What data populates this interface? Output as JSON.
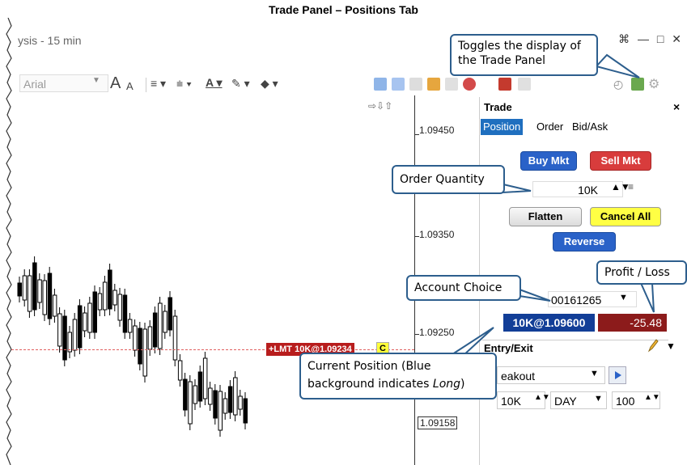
{
  "figure_title": "Trade Panel – Positions Tab",
  "window": {
    "title": "ysis - 15 min",
    "controls": "⌘ — □ ✕"
  },
  "toolbar": {
    "font": "Arial",
    "font_size_up": "A",
    "font_size_down": "A"
  },
  "chart": {
    "price_ticks": [
      "1.09450",
      "1.09350",
      "1.09250",
      "1.09158"
    ],
    "last_price": "1.09158",
    "lmt_order_label": "+LMT 10K@1.09234",
    "lmt_order_tag": "C",
    "nav_arrows": "⇨⇩⇧"
  },
  "trade_panel": {
    "title": "Trade",
    "close": "×",
    "tabs": [
      {
        "label": "Position",
        "active": true
      },
      {
        "label": "Order",
        "active": false
      },
      {
        "label": "Bid/Ask",
        "active": false
      }
    ],
    "buy_market": "Buy Mkt",
    "sell_market": "Sell Mkt",
    "quantity": "10K",
    "flatten": "Flatten",
    "cancel_all": "Cancel All",
    "reverse": "Reverse",
    "account": "00161265",
    "position": "10K@1.09600",
    "profit_loss": "-25.48",
    "entry_exit": {
      "title": "Entry/Exit",
      "strategy": "eakout",
      "qty": "10K",
      "duration": "DAY",
      "amount": "100"
    }
  },
  "callouts": {
    "toggle": "Toggles the display of the Trade Panel",
    "order_quantity": "Order Quantity",
    "profit_loss": "Profit / Loss",
    "account_choice": "Account Choice",
    "current_position_1": "Current Position (Blue",
    "current_position_2": "background indicates ",
    "current_position_em": "Long",
    "current_position_3": ")"
  },
  "colors": {
    "position_long": "#123e97",
    "loss": "#8c1b1b",
    "buy": "#2a62c8",
    "sell": "#d83c3c",
    "callout_border": "#2d5e8d"
  }
}
